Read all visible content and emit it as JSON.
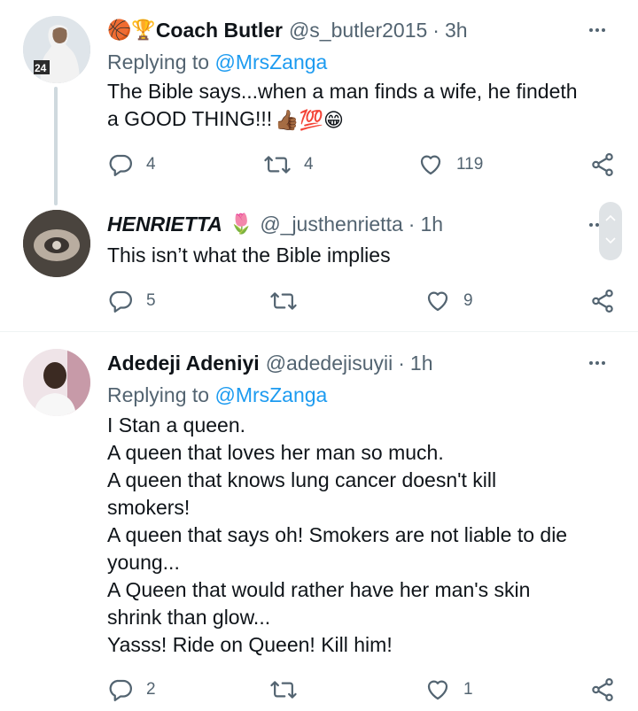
{
  "tweets": [
    {
      "badges": [
        "🏀",
        "🏆"
      ],
      "name": "Coach Butler",
      "handle": "@s_butler2015",
      "time": "3h",
      "reply_prefix": "Replying to",
      "reply_to": "@MrsZanga",
      "text_lines": [
        "The Bible says...when a man finds a wife, he findeth",
        "a GOOD THING!!!"
      ],
      "text_emojis": [
        "👍🏾",
        "💯",
        "😁"
      ],
      "replies": "4",
      "retweets": "4",
      "likes": "119"
    },
    {
      "name": "HENRIETTA",
      "name_emoji": "🌷",
      "handle": "@_justhenrietta",
      "time": "1h",
      "text_lines": [
        "This isn’t what the Bible implies"
      ],
      "replies": "5",
      "retweets": "",
      "likes": "9"
    },
    {
      "name": "Adedeji Adeniyi",
      "handle": "@adedejisuyii",
      "time": "1h",
      "reply_prefix": "Replying to",
      "reply_to": "@MrsZanga",
      "text_lines": [
        "I Stan a queen.",
        "A queen that loves her man so much.",
        "A queen that knows lung cancer doesn't kill",
        "smokers!",
        "A queen that says oh! Smokers are not liable to die",
        "young...",
        "A Queen that would rather have her man's skin",
        "shrink than glow...",
        "Yasss! Ride on Queen! Kill him!"
      ],
      "replies": "2",
      "retweets": "",
      "likes": "1"
    }
  ],
  "colors": {
    "text": "#0f1419",
    "secondary": "#536471",
    "link": "#1d9bf0",
    "thread_line": "#cfd9de"
  },
  "icons": {
    "reply": "reply-icon",
    "retweet": "retweet-icon",
    "like": "heart-icon",
    "share": "share-icon",
    "more": "more-icon"
  }
}
